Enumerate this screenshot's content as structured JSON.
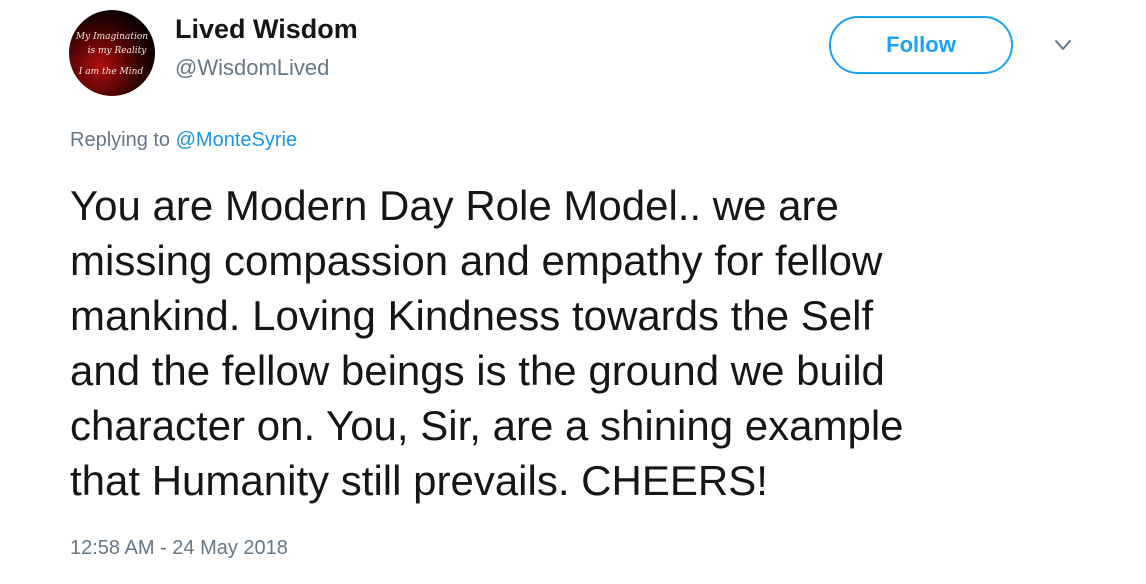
{
  "author": {
    "display_name": "Lived Wisdom",
    "handle": "@WisdomLived",
    "avatar_text": [
      "My Imagination",
      "is my Reality",
      "I am the Mind"
    ]
  },
  "actions": {
    "follow_label": "Follow",
    "more_icon": "chevron-down-icon"
  },
  "reply": {
    "prefix": "Replying to",
    "mention": "@MonteSyrie"
  },
  "tweet": {
    "lines": [
      "You are Modern Day Role Model.. we are",
      "missing compassion and empathy for fellow",
      "mankind. Loving Kindness towards the Self",
      "and the fellow beings is the ground we build",
      "character on. You, Sir, are a shining example",
      "that Humanity still prevails. CHEERS!"
    ],
    "timestamp": "12:58 AM - 24 May 2018"
  },
  "colors": {
    "accent": "#1da1f2",
    "link": "#1b95e0",
    "secondary_text": "#657786",
    "primary_text": "#14171a"
  }
}
